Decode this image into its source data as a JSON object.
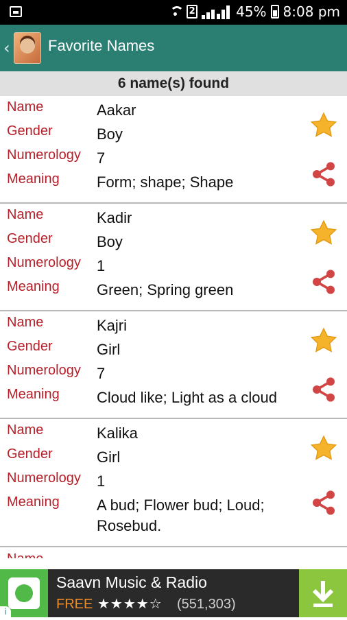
{
  "status_bar": {
    "network": "2",
    "battery": "45%",
    "time": "8:08 pm"
  },
  "app_bar": {
    "title": "Favorite Names"
  },
  "summary": "6 name(s) found",
  "labels": {
    "name": "Name",
    "gender": "Gender",
    "numerology": "Numerology",
    "meaning": "Meaning"
  },
  "names": [
    {
      "name": "Aakar",
      "gender": "Boy",
      "numerology": "7",
      "meaning": "Form; shape; Shape"
    },
    {
      "name": "Kadir",
      "gender": "Boy",
      "numerology": "1",
      "meaning": "Green; Spring green"
    },
    {
      "name": "Kajri",
      "gender": "Girl",
      "numerology": "7",
      "meaning": "Cloud like; Light as a cloud"
    },
    {
      "name": "Kalika",
      "gender": "Girl",
      "numerology": "1",
      "meaning": "A bud; Flower bud; Loud; Rosebud."
    }
  ],
  "ad": {
    "title": "Saavn Music & Radio",
    "price": "FREE",
    "rating_stars": "★★★★☆",
    "rating_count": "(551,303)"
  },
  "colors": {
    "app_bar": "#2a7f72",
    "label": "#b5202a",
    "star": "#f4b32b",
    "share": "#d24545"
  }
}
